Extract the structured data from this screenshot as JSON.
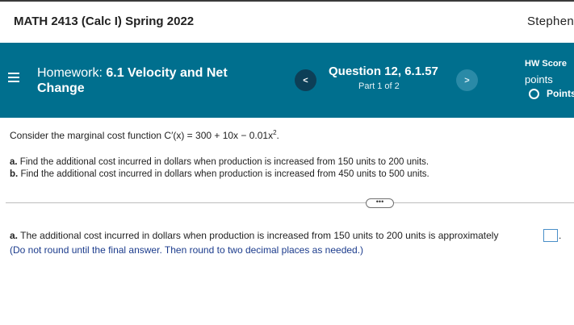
{
  "header": {
    "course_title": "MATH 2413 (Calc I) Spring 2022",
    "user_name": "Stephen"
  },
  "hw_bar": {
    "homework_prefix": "Homework:",
    "homework_name": "6.1 Velocity and Net Change",
    "question_title": "Question 12, 6.1.57",
    "question_part": "Part 1 of 2",
    "prev_symbol": "<",
    "next_symbol": ">",
    "score_title": "HW Score",
    "score_sub": "points",
    "score_points": "Points"
  },
  "problem": {
    "prompt_text": "Consider the marginal cost function C′(x) = 300 + 10x − 0.01x",
    "prompt_exponent": "2",
    "prompt_end": ".",
    "item_a_label": "a.",
    "item_a_text": "Find the additional cost incurred in dollars when production is increased from 150 units to 200 units.",
    "item_b_label": "b.",
    "item_b_text": "Find the additional cost incurred in dollars when production is increased from 450 units to 500 units."
  },
  "expand_button_label": "•••",
  "answer": {
    "label": "a.",
    "text": "The additional cost incurred in dollars when production is increased from 150 units to 200 units is approximately",
    "value": "",
    "end": ".",
    "hint": "(Do not round until the final answer. Then round to two decimal places as needed.)"
  }
}
